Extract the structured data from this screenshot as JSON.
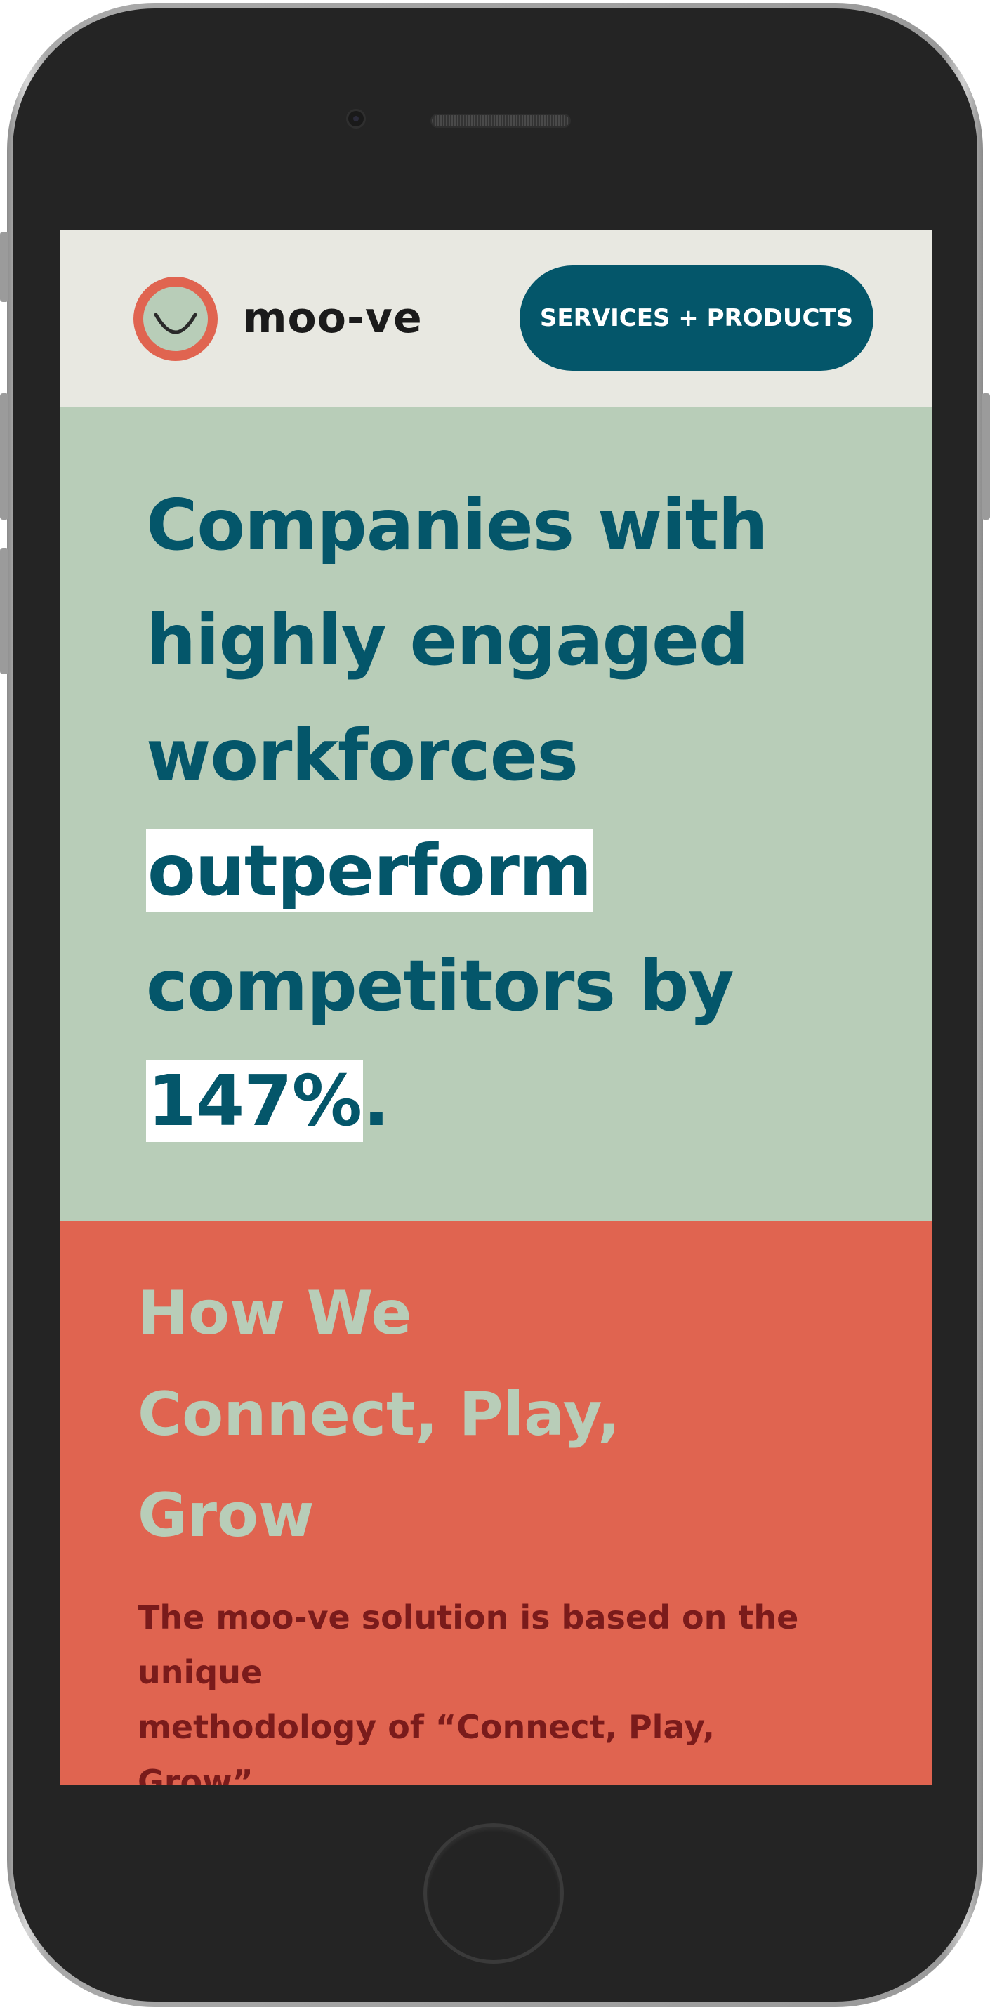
{
  "header": {
    "brand_name": "moo-ve",
    "nav_button_label": "SERVICES + PRODUCTS"
  },
  "hero": {
    "title_line1": "Companies with",
    "title_line2": "highly engaged",
    "title_line3": "workforces",
    "title_highlight1": "outperform",
    "title_line5": "competitors by",
    "title_highlight2": "147%",
    "title_end": "."
  },
  "section": {
    "title_line1": "How We",
    "title_line2": "Connect, Play,",
    "title_line3": "Grow",
    "body_line1": "The moo-ve solution is based on the",
    "body_line2": "unique",
    "body_line3": "methodology of “Connect, Play,",
    "body_line4": "Grow”"
  },
  "colors": {
    "header_bg": "#e8e8e1",
    "brand_teal": "#04566a",
    "sage": "#b8cdb8",
    "coral": "#e06450",
    "body_text": "#7a1b1b"
  },
  "icons": {
    "logo": "smiley-face-icon",
    "home": "home-button-icon"
  }
}
